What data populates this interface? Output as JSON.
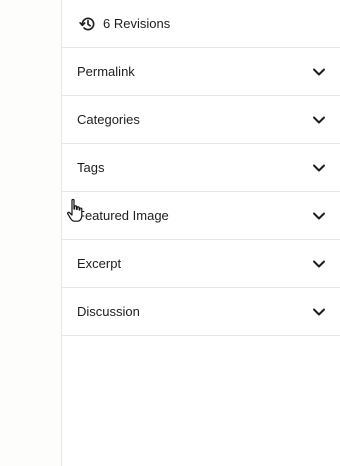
{
  "revisions": {
    "label": "6 Revisions",
    "icon": "history-icon"
  },
  "panels": [
    {
      "label": "Permalink"
    },
    {
      "label": "Categories"
    },
    {
      "label": "Tags"
    },
    {
      "label": "Featured Image"
    },
    {
      "label": "Excerpt"
    },
    {
      "label": "Discussion"
    }
  ],
  "colors": {
    "text": "#1e1e1e",
    "border": "#e6e6e6",
    "background": "#ffffff"
  }
}
